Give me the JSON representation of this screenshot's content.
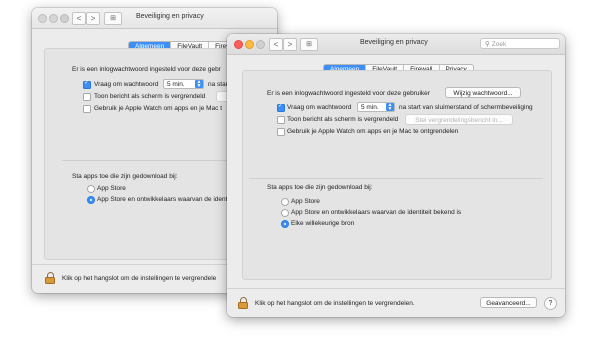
{
  "window_title": "Beveiliging en privacy",
  "search_placeholder": "Zoek",
  "nav": {
    "back": "<",
    "forward": ">",
    "grid": "⊞"
  },
  "tabs": [
    "Algemeen",
    "FileVault",
    "Firewall",
    "Privacy"
  ],
  "back_window": {
    "tabs": [
      "Algemeen",
      "FileVault",
      "Firew"
    ],
    "password_text": "Er is een inlogwachtwoord ingesteld voor deze gebr",
    "require_password": "Vraag om wachtwoord",
    "require_password_value": "5 min.",
    "require_password_suffix": "na start",
    "show_message": "Toon bericht als scherm is vergrendeld",
    "show_message_btn": "Ste",
    "apple_watch": "Gebruik je Apple Watch om apps en je Mac t",
    "allow_apps": "Sta apps toe die zijn gedownload bij:",
    "radio_1": "App Store",
    "radio_2": "App Store en ontwikkelaars waarvan de identi",
    "lock_text": "Klik op het hangslot om de instellingen te vergrendele"
  },
  "front_window": {
    "password_text": "Er is een inlogwachtwoord ingesteld voor deze gebruiker",
    "change_password": "Wijzig wachtwoord...",
    "require_password": "Vraag om wachtwoord",
    "require_password_value": "5 min.",
    "require_password_suffix": "na start van sluimerstand of schermbeveiliging",
    "show_message": "Toon bericht als scherm is vergrendeld",
    "set_lock_message": "Stel vergrendelingsbericht in...",
    "apple_watch": "Gebruik je Apple Watch om apps en je Mac te ontgrendelen",
    "allow_apps": "Sta apps toe die zijn gedownload bij:",
    "radio_1": "App Store",
    "radio_2": "App Store en ontwikkelaars waarvan de identiteit bekend is",
    "radio_3": "Elke willekeurige bron",
    "lock_text": "Klik op het hangslot om de instellingen te vergrendelen.",
    "advanced": "Geavanceerd...",
    "help": "?"
  },
  "colors": {
    "accent": "#3d8ff7",
    "window_bg": "#ececec"
  }
}
